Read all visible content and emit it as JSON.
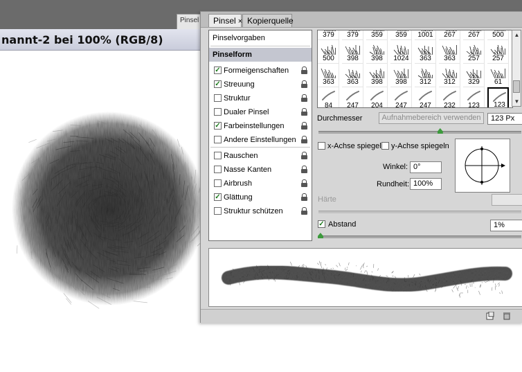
{
  "document": {
    "hidden_tab_label": "Pinsel",
    "title": "nannt-2 bei 100% (RGB/8)"
  },
  "panel": {
    "tabs": [
      {
        "label": "Pinsel",
        "active": true
      },
      {
        "label": "Kopierquelle",
        "active": false
      }
    ],
    "close_glyph": "×",
    "list": {
      "presets_label": "Pinselvorgaben",
      "form_label": "Pinselform",
      "options": [
        {
          "label": "Formeigenschaften",
          "checked": true
        },
        {
          "label": "Streuung",
          "checked": true
        },
        {
          "label": "Struktur",
          "checked": false
        },
        {
          "label": "Dualer Pinsel",
          "checked": false
        },
        {
          "label": "Farbeinstellungen",
          "checked": true
        },
        {
          "label": "Andere Einstellungen",
          "checked": false
        },
        {
          "label": "Rauschen",
          "checked": false
        },
        {
          "label": "Nasse Kanten",
          "checked": false
        },
        {
          "label": "Airbrush",
          "checked": false
        },
        {
          "label": "Glättung",
          "checked": true
        },
        {
          "label": "Struktur schützen",
          "checked": false
        }
      ],
      "check_glyph": "✓"
    },
    "brush_grid": {
      "rows": [
        [
          "379",
          "379",
          "359",
          "359",
          "1001",
          "267",
          "267",
          "500"
        ],
        [
          "500",
          "398",
          "398",
          "1024",
          "363",
          "363",
          "257",
          "257"
        ],
        [
          "363",
          "363",
          "398",
          "398",
          "312",
          "312",
          "329",
          "61"
        ],
        [
          "84",
          "247",
          "204",
          "247",
          "247",
          "232",
          "123",
          "123"
        ]
      ],
      "selected": [
        3,
        7
      ]
    },
    "diameter": {
      "label": "Durchmesser",
      "sample_button": "Aufnahmebereich verwenden",
      "value": "123 Px",
      "slider_fraction": 0.6
    },
    "flip_x_label": "x-Achse spiegeln",
    "flip_y_label": "y-Achse spiegeln",
    "angle": {
      "label": "Winkel:",
      "value": "0°"
    },
    "roundness": {
      "label": "Rundheit:",
      "value": "100%"
    },
    "hardness": {
      "label": "Härte"
    },
    "spacing": {
      "label": "Abstand",
      "checked": true,
      "value": "1%",
      "slider_fraction": 0.01
    },
    "colors": {
      "accent_green": "#3c9a3c",
      "panel_bg": "#d6d6d6",
      "selection": "#c4c6d0"
    }
  }
}
